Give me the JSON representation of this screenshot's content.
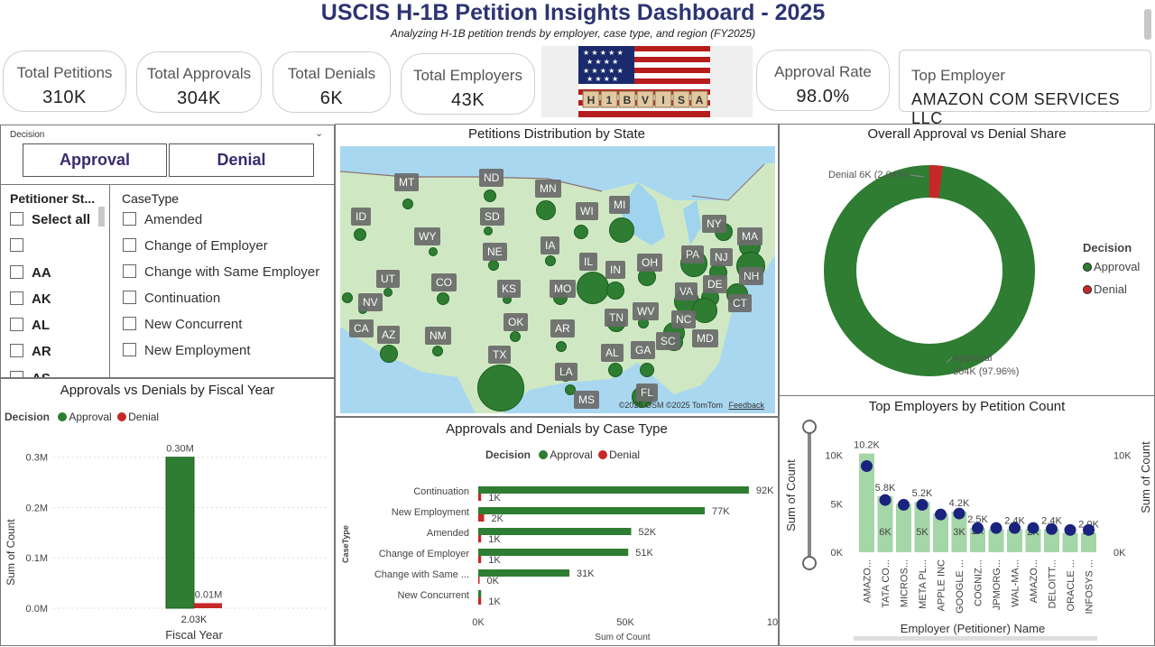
{
  "header": {
    "title": "USCIS H-1B Petition Insights Dashboard - 2025",
    "subtitle": "Analyzing H-1B petition trends by employer, case type, and region (FY2025)"
  },
  "kpis": {
    "total_petitions": {
      "label": "Total Petitions",
      "value": "310K"
    },
    "total_approvals": {
      "label": "Total Approvals",
      "value": "304K"
    },
    "total_denials": {
      "label": "Total Denials",
      "value": "6K"
    },
    "total_employers": {
      "label": "Total Employers",
      "value": "43K"
    },
    "approval_rate": {
      "label": "Approval Rate",
      "value": "98.0%"
    },
    "top_employer": {
      "label": "Top Employer",
      "value": "AMAZON COM SERVICES LLC"
    }
  },
  "banner": {
    "tiles": [
      "H",
      "1",
      "B",
      "V",
      "I",
      "S",
      "A"
    ]
  },
  "decision_slicer": {
    "label": "Decision",
    "options": [
      "Approval",
      "Denial"
    ]
  },
  "state_slicer": {
    "header": "Petitioner St...",
    "items": [
      "Select all",
      "",
      "AA",
      "AK",
      "AL",
      "AR",
      "AS"
    ]
  },
  "casetype_slicer": {
    "header": "CaseType",
    "items": [
      "Amended",
      "Change of Employer",
      "Change with Same Employer",
      "Continuation",
      "New Concurrent",
      "New Employment"
    ]
  },
  "map": {
    "title": "Petitions Distribution by State",
    "attribution": "©2025 OSM  ©2025 TomTom",
    "feedback": "Feedback",
    "states": [
      "MT",
      "ND",
      "MN",
      "ID",
      "WY",
      "SD",
      "WI",
      "MI",
      "NY",
      "MA",
      "NE",
      "IA",
      "IL",
      "IN",
      "OH",
      "PA",
      "NJ",
      "NH",
      "UT",
      "CO",
      "KS",
      "MO",
      "VA",
      "DE",
      "CT",
      "NV",
      "WV",
      "TN",
      "NC",
      "OK",
      "CA",
      "AZ",
      "NM",
      "AR",
      "SC",
      "MD",
      "AL",
      "GA",
      "TX",
      "LA",
      "FL",
      "MS"
    ]
  },
  "donut": {
    "title": "Overall Approval vs Denial Share",
    "legend_title": "Decision",
    "legend": [
      "Approval",
      "Denial"
    ],
    "denial_label": "Denial 6K (2.04%)",
    "approval_label_1": "Approval",
    "approval_label_2": "304K (97.96%)",
    "colors": {
      "approval": "#2e7d32",
      "denial": "#c62828"
    }
  },
  "colors": {
    "approval": "#2e7d32",
    "denial": "#c62828",
    "bar_light": "#a5d6a7",
    "marker": "#1a237e",
    "title_blue": "#2c3473"
  },
  "chart_data": [
    {
      "type": "bar",
      "title": "Approvals vs Denials by Fiscal Year",
      "legend_title": "Decision",
      "categories": [
        "2.03K"
      ],
      "xlabel": "Fiscal Year",
      "ylabel": "Sum of Count",
      "yticks": [
        "0.0M",
        "0.1M",
        "0.2M",
        "0.3M"
      ],
      "ylim": [
        0,
        0.33
      ],
      "series": [
        {
          "name": "Approval",
          "values": [
            0.3
          ],
          "labels": [
            "0.30M"
          ]
        },
        {
          "name": "Denial",
          "values": [
            0.01
          ],
          "labels": [
            "0.01M"
          ]
        }
      ]
    },
    {
      "type": "bar",
      "orientation": "horizontal",
      "title": "Approvals and Denials by Case Type",
      "legend_title": "Decision",
      "categories": [
        "Continuation",
        "New Employment",
        "Amended",
        "Change of Employer",
        "Change with Same ...",
        "New Concurrent"
      ],
      "ylabel": "CaseType",
      "xlabel": "Sum of Count",
      "xticks": [
        "0K",
        "50K",
        "10"
      ],
      "xlim": [
        0,
        100
      ],
      "series": [
        {
          "name": "Approval",
          "values": [
            92,
            77,
            52,
            51,
            31,
            1
          ],
          "labels": [
            "92K",
            "77K",
            "52K",
            "51K",
            "31K",
            ""
          ]
        },
        {
          "name": "Denial",
          "values": [
            1,
            2,
            1,
            1,
            0,
            1
          ],
          "labels": [
            "1K",
            "2K",
            "1K",
            "1K",
            "0K",
            "1K"
          ]
        }
      ]
    },
    {
      "type": "bar",
      "title": "Top Employers by Petition Count",
      "categories": [
        "AMAZO...",
        "TATA CO...",
        "MICROS...",
        "META PL...",
        "APPLE INC",
        "GOOGLE ...",
        "COGNIZ...",
        "JPMORG...",
        "WAL-MA...",
        "AMAZO...",
        "DELOITT...",
        "ORACLE ...",
        "INFOSYS ..."
      ],
      "xlabel": "Employer (Petitioner) Name",
      "ylabel": "Sum of Count",
      "ylabel_right": "Sum of Count",
      "yticks": [
        "0K",
        "5K",
        "10K"
      ],
      "yticks_right": [
        "0K",
        "10K"
      ],
      "ylim": [
        0,
        11
      ],
      "series": [
        {
          "name": "Sum of Count",
          "values": [
            10.2,
            5.8,
            5.0,
            5.2,
            4.0,
            4.2,
            2.5,
            2.4,
            2.4,
            2.4,
            2.4,
            2.0,
            2.0
          ],
          "top_labels": [
            "10.2K",
            "5.8K",
            "",
            "5.2K",
            "",
            "4.2K",
            "2.5K",
            "",
            "2.4K",
            "",
            "2.4K",
            "",
            "2.0K"
          ],
          "inner_labels": [
            "",
            "6K",
            "",
            "5K",
            "",
            "3K",
            "2K",
            "",
            "",
            "2K",
            "",
            "",
            "2K"
          ],
          "mid_labels": [
            "",
            "",
            "",
            "5K",
            "",
            "",
            "",
            "",
            "",
            "",
            "",
            "",
            ""
          ]
        },
        {
          "name": "Marker",
          "values": [
            8.9,
            5.4,
            4.9,
            4.9,
            3.9,
            4.0,
            2.5,
            2.5,
            2.5,
            2.5,
            2.4,
            2.3,
            2.3
          ]
        }
      ]
    }
  ]
}
